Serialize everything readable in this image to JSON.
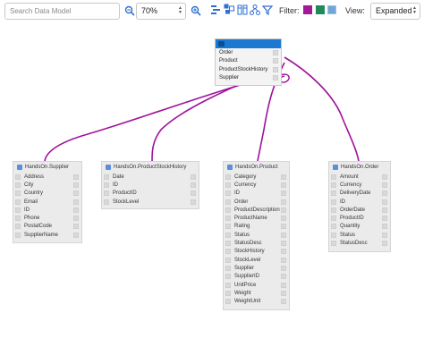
{
  "toolbar": {
    "search_placeholder": "Search Data Model",
    "zoom_value": "70%",
    "filter_label": "Filter:",
    "view_label": "View:",
    "view_value": "Expanded",
    "colors": {
      "icon_blue": "#2f6fd1",
      "filter_purple": "#a21a9a",
      "filter_green": "#1f8a5a",
      "filter_lightblue": "#6fa6d8"
    }
  },
  "root": {
    "title": "",
    "rows": [
      "Order",
      "Product",
      "ProductStockHistory",
      "Supplier"
    ]
  },
  "entities": [
    {
      "title": "HandsOn.Supplier",
      "fields": [
        "Address",
        "City",
        "Country",
        "Email",
        "ID",
        "Phone",
        "PostalCode",
        "SupplierName"
      ]
    },
    {
      "title": "HandsOn.ProductStockHistory",
      "fields": [
        "Date",
        "ID",
        "ProductID",
        "StockLevel"
      ]
    },
    {
      "title": "HandsOn.Product",
      "fields": [
        "Category",
        "Currency",
        "ID",
        "Order",
        "ProductDescription",
        "ProductName",
        "Rating",
        "Status",
        "StatusDesc",
        "StockHistory",
        "StockLevel",
        "Supplier",
        "SupplierID",
        "UnitPrice",
        "Weight",
        "WeightUnit"
      ]
    },
    {
      "title": "HandsOn.Order",
      "fields": [
        "Amount",
        "Currency",
        "DeliveryDate",
        "ID",
        "OrderDate",
        "ProductID",
        "Quantity",
        "Status",
        "StatusDesc"
      ]
    }
  ],
  "link_color": "#a0109c"
}
